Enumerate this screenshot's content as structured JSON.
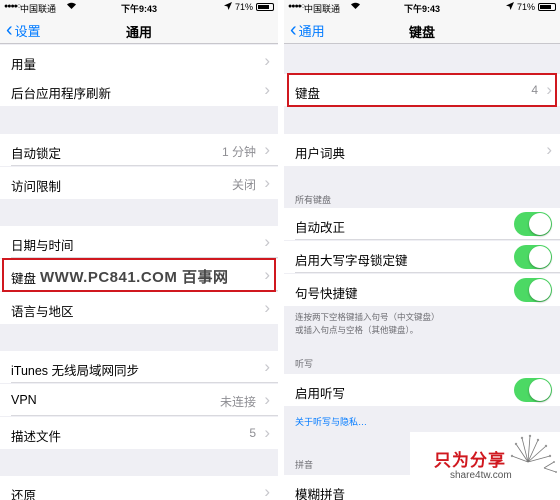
{
  "status_bar": {
    "signal": "●●●●○",
    "carrier": "中国联通",
    "time": "下午9:43",
    "battery": "71%",
    "battery_level": 0.71
  },
  "left_screen": {
    "nav": {
      "back": "设置",
      "title": "通用"
    },
    "rows": {
      "usage": "用量",
      "bg_refresh": "后台应用程序刷新",
      "auto_lock": "自动锁定",
      "auto_lock_value": "1 分钟",
      "restrictions": "访问限制",
      "restrictions_value": "关闭",
      "date_time": "日期与时间",
      "keyboard": "键盘",
      "language_region": "语言与地区",
      "itunes_sync": "iTunes 无线局域网同步",
      "vpn": "VPN",
      "vpn_value": "未连接",
      "profiles": "描述文件",
      "profiles_value": "5",
      "reset": "还原"
    },
    "watermark": "WWW.PC841.COM 百事网"
  },
  "right_screen": {
    "nav": {
      "back": "通用",
      "title": "键盘"
    },
    "rows": {
      "keyboards": "键盘",
      "keyboards_value": "4",
      "user_dictionary": "用户词典",
      "auto_correct": "自动改正",
      "caps_lock": "启用大写字母锁定键",
      "shortcut": "句号快捷键",
      "dictation": "启用听写",
      "fuzzy_pinyin": "模糊拼音"
    },
    "toggles": {
      "auto_correct": true,
      "caps_lock": true,
      "shortcut": true,
      "dictation": true
    },
    "headers": {
      "all_keyboards": "所有键盘",
      "dictation": "听写",
      "pinyin": "拼音"
    },
    "shortcut_note_1": "连按两下空格键插入句号（中文键盘）",
    "shortcut_note_2": "或插入句点与空格（其他键盘）。",
    "dictation_link": "关于听写与隐私…"
  },
  "logo": {
    "main": "只为分享",
    "sub": "share4tw.com"
  },
  "colors": {
    "highlight": "#d0181f",
    "toggle_on": "#4cd964",
    "ios_blue": "#007aff"
  }
}
